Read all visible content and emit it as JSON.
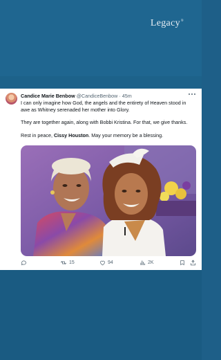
{
  "brand": {
    "logo_text": "Legacy"
  },
  "tweet": {
    "display_name": "Candice Marie Benbow",
    "handle": "@CandiceBenbow",
    "separator": "·",
    "time": "45m",
    "more_icon": "more-horizontal-icon",
    "paragraphs": {
      "p1": "I can only imagine how God, the angels and the entirety of Heaven stood in awe as Whitney serenaded her mother into Glory.",
      "p2": "They are together again, along with Bobbi Kristina. For that, we give thanks.",
      "p3_before": "Rest in peace, ",
      "p3_bold": "Cissy Houston",
      "p3_after": ". May your memory be a blessing."
    },
    "actions": {
      "reply_count": "",
      "retweet_count": "15",
      "like_count": "94",
      "views_count": "2K"
    }
  },
  "colors": {
    "background": "#1e5f88",
    "card": "#ffffff",
    "text_primary": "#0f1419",
    "text_secondary": "#536471"
  }
}
